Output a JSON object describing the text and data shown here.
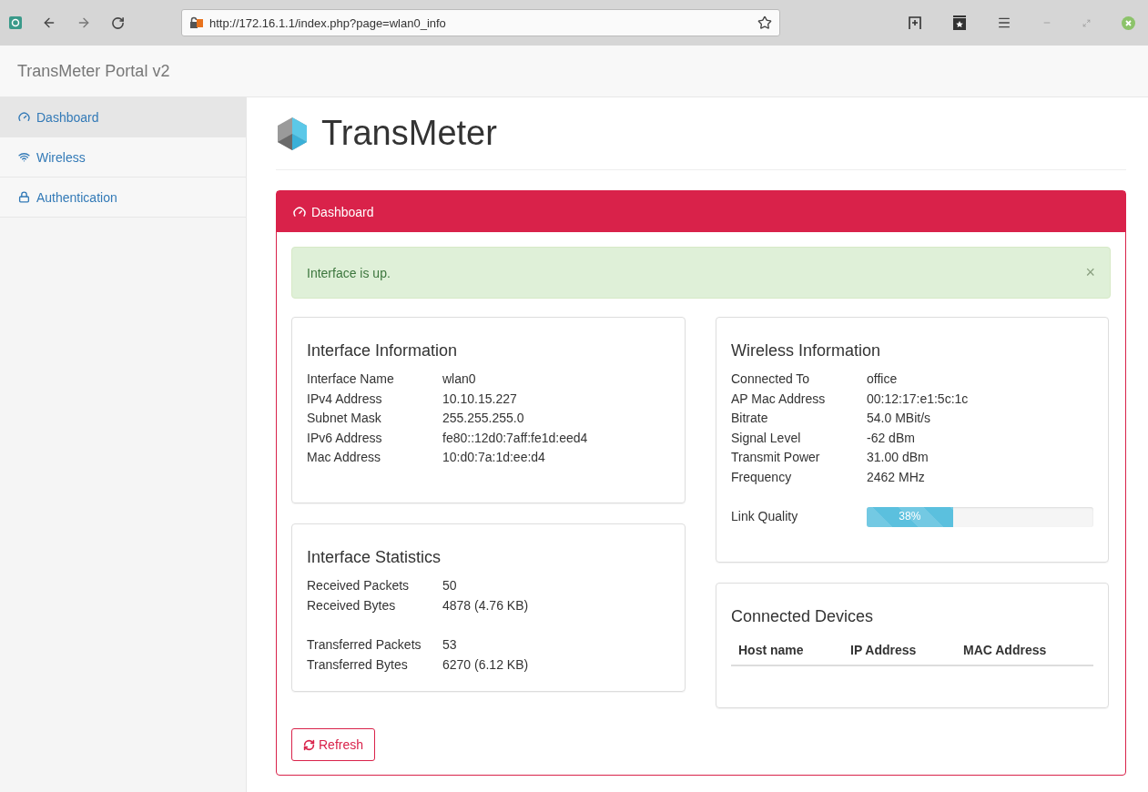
{
  "browser": {
    "url": "http://172.16.1.1/index.php?page=wlan0_info"
  },
  "navbar": {
    "brand": "TransMeter Portal v2"
  },
  "sidebar": {
    "items": [
      {
        "label": "Dashboard",
        "selected": true
      },
      {
        "label": "Wireless",
        "selected": false
      },
      {
        "label": "Authentication",
        "selected": false
      }
    ]
  },
  "page_title": "TransMeter",
  "panel": {
    "title": "Dashboard",
    "alert": {
      "text": "Interface is up.",
      "dismiss": "×"
    },
    "interface_info": {
      "title": "Interface Information",
      "rows": [
        {
          "label": "Interface Name",
          "value": "wlan0"
        },
        {
          "label": "IPv4 Address",
          "value": "10.10.15.227"
        },
        {
          "label": "Subnet Mask",
          "value": "255.255.255.0"
        },
        {
          "label": "IPv6 Address",
          "value": "fe80::12d0:7aff:fe1d:eed4"
        },
        {
          "label": "Mac Address",
          "value": "10:d0:7a:1d:ee:d4"
        }
      ]
    },
    "interface_stats": {
      "title": "Interface Statistics",
      "groups": [
        [
          {
            "label": "Received Packets",
            "value": "50"
          },
          {
            "label": "Received Bytes",
            "value": "4878 (4.76 KB)"
          }
        ],
        [
          {
            "label": "Transferred Packets",
            "value": "53"
          },
          {
            "label": "Transferred Bytes",
            "value": "6270 (6.12 KB)"
          }
        ]
      ]
    },
    "wireless_info": {
      "title": "Wireless Information",
      "rows": [
        {
          "label": "Connected To",
          "value": "office"
        },
        {
          "label": "AP Mac Address",
          "value": "00:12:17:e1:5c:1c"
        },
        {
          "label": "Bitrate",
          "value": "54.0 MBit/s"
        },
        {
          "label": "Signal Level",
          "value": "-62 dBm"
        },
        {
          "label": "Transmit Power",
          "value": "31.00 dBm"
        },
        {
          "label": "Frequency",
          "value": "2462 MHz"
        }
      ],
      "link_quality": {
        "label": "Link Quality",
        "level": 0.38,
        "reading": "38%"
      }
    },
    "connected_devices": {
      "title": "Connected Devices",
      "columns": [
        "Host name",
        "IP Address",
        "MAC Address"
      ]
    },
    "refresh_button": "Refresh"
  }
}
